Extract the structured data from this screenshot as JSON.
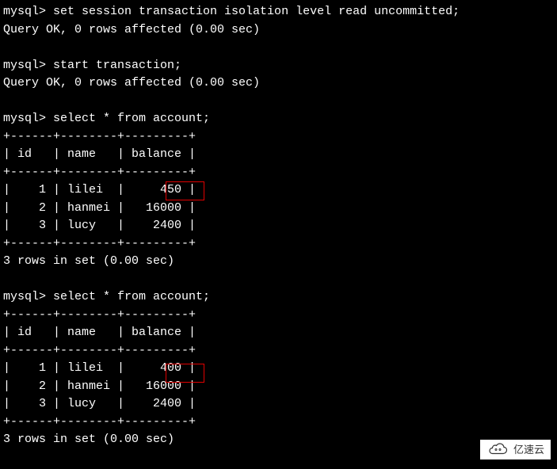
{
  "prompt": "mysql> ",
  "commands": {
    "set_isolation": "set session transaction isolation level read uncommitted;",
    "start_tx": "start transaction;",
    "select_account": "select * from account;"
  },
  "responses": {
    "query_ok": "Query OK, 0 rows affected (0.00 sec)",
    "rows_in_set": "3 rows in set (0.00 sec)"
  },
  "table": {
    "border_top": "+------+--------+---------+",
    "header": "| id   | name   | balance |",
    "border_mid": "+------+--------+---------+"
  },
  "table1_rows": {
    "r1": "|    1 | lilei  |     450 |",
    "r2": "|    2 | hanmei |   16000 |",
    "r3": "|    3 | lucy   |    2400 |"
  },
  "table2_rows": {
    "r1": "|    1 | lilei  |     400 |",
    "r2": "|    2 | hanmei |   16000 |",
    "r3": "|    3 | lucy   |    2400 |"
  },
  "chart_data": {
    "type": "table",
    "title": "account",
    "columns": [
      "id",
      "name",
      "balance"
    ],
    "query1_rows": [
      {
        "id": 1,
        "name": "lilei",
        "balance": 450
      },
      {
        "id": 2,
        "name": "hanmei",
        "balance": 16000
      },
      {
        "id": 3,
        "name": "lucy",
        "balance": 2400
      }
    ],
    "query2_rows": [
      {
        "id": 1,
        "name": "lilei",
        "balance": 400
      },
      {
        "id": 2,
        "name": "hanmei",
        "balance": 16000
      },
      {
        "id": 3,
        "name": "lucy",
        "balance": 2400
      }
    ]
  },
  "watermark_text": "亿速云"
}
